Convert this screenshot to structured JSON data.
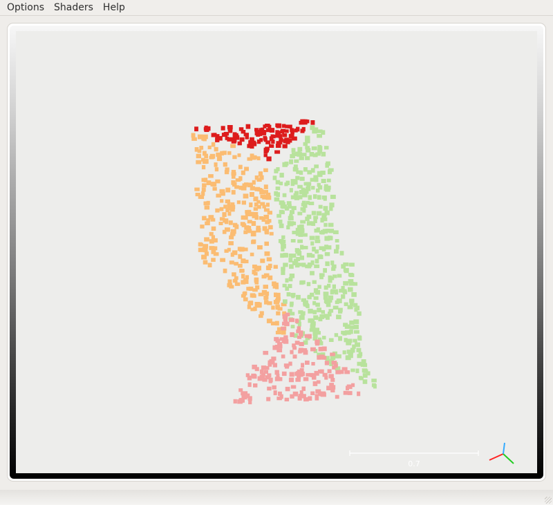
{
  "menu": {
    "items": [
      "Options",
      "Shaders",
      "Help"
    ]
  },
  "viewer": {
    "scale_label": "0.7",
    "colors": {
      "red": "#dd1c1c",
      "orange": "#fbbc72",
      "green": "#b8e29c",
      "pink": "#f3a0a0",
      "axis_x": "#ff2222",
      "axis_y": "#22cc22",
      "axis_z": "#33aaff"
    }
  }
}
